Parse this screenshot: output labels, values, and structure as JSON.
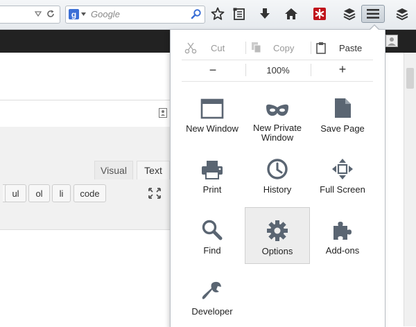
{
  "toolbar": {
    "search_placeholder": "Google",
    "search_engine_letter": "g"
  },
  "editor": {
    "tabs": [
      {
        "label": "Visual"
      },
      {
        "label": "Text"
      }
    ],
    "quicktags": [
      {
        "label": "ul"
      },
      {
        "label": "ol"
      },
      {
        "label": "li"
      },
      {
        "label": "code"
      }
    ]
  },
  "menu": {
    "edit": {
      "cut": "Cut",
      "copy": "Copy",
      "paste": "Paste"
    },
    "zoom": {
      "minus": "−",
      "level": "100%",
      "plus": "+"
    },
    "items": [
      {
        "label": "New Window",
        "icon": "window-icon"
      },
      {
        "label": "New Private\nWindow",
        "icon": "mask-icon"
      },
      {
        "label": "Save Page",
        "icon": "page-icon"
      },
      {
        "label": "Print",
        "icon": "printer-icon"
      },
      {
        "label": "History",
        "icon": "clock-icon"
      },
      {
        "label": "Full Screen",
        "icon": "fullscreen-icon"
      },
      {
        "label": "Find",
        "icon": "magnifier-icon"
      },
      {
        "label": "Options",
        "icon": "gear-icon",
        "hovered": true
      },
      {
        "label": "Add-ons",
        "icon": "puzzle-icon"
      },
      {
        "label": "Developer",
        "icon": "wrench-icon"
      }
    ]
  },
  "colors": {
    "icon_gray": "#5a6572",
    "addon_red": "#c0141b",
    "google_blue": "#3b6fd6"
  }
}
